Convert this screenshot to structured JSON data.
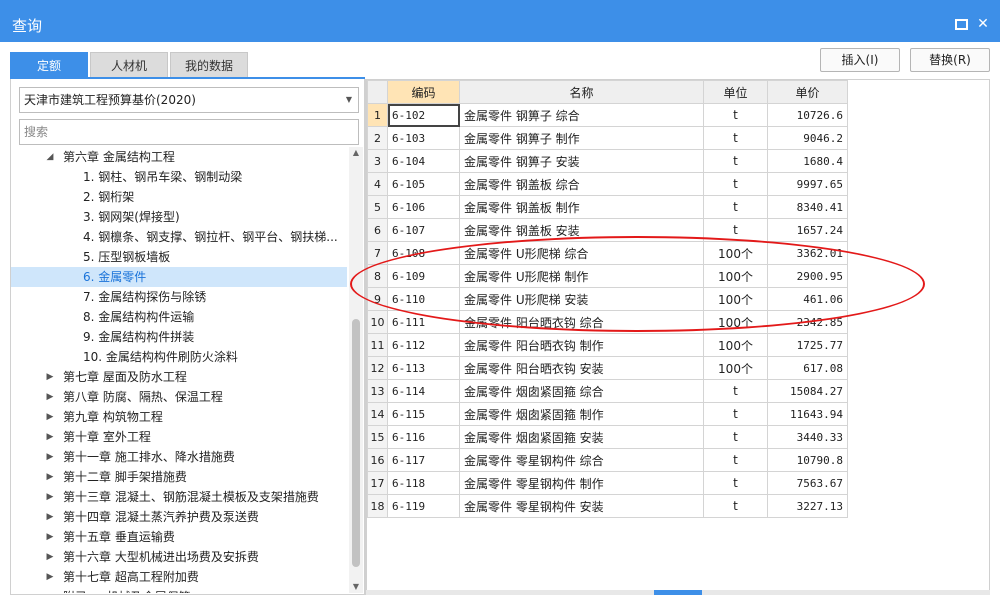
{
  "window": {
    "title": "查询"
  },
  "tabs": [
    "定额",
    "人材机",
    "我的数据"
  ],
  "actions": {
    "insert_label": "插入(I)",
    "replace_label": "替换(R)"
  },
  "left": {
    "selected_base": "天津市建筑工程预算基价(2020)",
    "search_placeholder": "搜索",
    "tree": [
      {
        "label": "第六章 金属结构工程",
        "level": 1,
        "expanded": true
      },
      {
        "label": "1. 钢柱、钢吊车梁、钢制动梁",
        "level": 2
      },
      {
        "label": "2. 钢桁架",
        "level": 2
      },
      {
        "label": "3. 钢网架(焊接型)",
        "level": 2
      },
      {
        "label": "4. 钢檩条、钢支撑、钢拉杆、钢平台、钢扶梯...",
        "level": 2
      },
      {
        "label": "5. 压型钢板墙板",
        "level": 2
      },
      {
        "label": "6. 金属零件",
        "level": 2,
        "selected": true
      },
      {
        "label": "7. 金属结构探伤与除锈",
        "level": 2
      },
      {
        "label": "8. 金属结构构件运输",
        "level": 2
      },
      {
        "label": "9. 金属结构构件拼装",
        "level": 2
      },
      {
        "label": "10. 金属结构构件刷防火涂料",
        "level": 2
      },
      {
        "label": "第七章 屋面及防水工程",
        "level": 1
      },
      {
        "label": "第八章 防腐、隔热、保温工程",
        "level": 1
      },
      {
        "label": "第九章 构筑物工程",
        "level": 1
      },
      {
        "label": "第十章 室外工程",
        "level": 1
      },
      {
        "label": "第十一章 施工排水、降水措施费",
        "level": 1
      },
      {
        "label": "第十二章 脚手架措施费",
        "level": 1
      },
      {
        "label": "第十三章 混凝土、钢筋混凝土模板及支架措施费",
        "level": 1
      },
      {
        "label": "第十四章 混凝土蒸汽养护费及泵送费",
        "level": 1
      },
      {
        "label": "第十五章 垂直运输费",
        "level": 1
      },
      {
        "label": "第十六章 大型机械进出场费及安拆费",
        "level": 1
      },
      {
        "label": "第十七章 超高工程附加费",
        "level": 1
      },
      {
        "label": "附录 一 机械及金属保管",
        "level": 1
      }
    ]
  },
  "grid": {
    "columns": [
      "编码",
      "名称",
      "单位",
      "单价"
    ],
    "rows": [
      {
        "idx": "1",
        "code": "6-102",
        "name": "金属零件 钢箅子 综合",
        "unit": "t",
        "price": "10726.6"
      },
      {
        "idx": "2",
        "code": "6-103",
        "name": "金属零件 钢箅子 制作",
        "unit": "t",
        "price": "9046.2"
      },
      {
        "idx": "3",
        "code": "6-104",
        "name": "金属零件 钢箅子 安装",
        "unit": "t",
        "price": "1680.4"
      },
      {
        "idx": "4",
        "code": "6-105",
        "name": "金属零件 钢盖板 综合",
        "unit": "t",
        "price": "9997.65"
      },
      {
        "idx": "5",
        "code": "6-106",
        "name": "金属零件 钢盖板 制作",
        "unit": "t",
        "price": "8340.41"
      },
      {
        "idx": "6",
        "code": "6-107",
        "name": "金属零件 钢盖板 安装",
        "unit": "t",
        "price": "1657.24"
      },
      {
        "idx": "7",
        "code": "6-108",
        "name": "金属零件 U形爬梯 综合",
        "unit": "100个",
        "price": "3362.01"
      },
      {
        "idx": "8",
        "code": "6-109",
        "name": "金属零件 U形爬梯 制作",
        "unit": "100个",
        "price": "2900.95"
      },
      {
        "idx": "9",
        "code": "6-110",
        "name": "金属零件 U形爬梯 安装",
        "unit": "100个",
        "price": "461.06"
      },
      {
        "idx": "10",
        "code": "6-111",
        "name": "金属零件 阳台晒衣钩 综合",
        "unit": "100个",
        "price": "2342.85"
      },
      {
        "idx": "11",
        "code": "6-112",
        "name": "金属零件 阳台晒衣钩 制作",
        "unit": "100个",
        "price": "1725.77"
      },
      {
        "idx": "12",
        "code": "6-113",
        "name": "金属零件 阳台晒衣钩 安装",
        "unit": "100个",
        "price": "617.08"
      },
      {
        "idx": "13",
        "code": "6-114",
        "name": "金属零件 烟囱紧固箍 综合",
        "unit": "t",
        "price": "15084.27"
      },
      {
        "idx": "14",
        "code": "6-115",
        "name": "金属零件 烟囱紧固箍 制作",
        "unit": "t",
        "price": "11643.94"
      },
      {
        "idx": "15",
        "code": "6-116",
        "name": "金属零件 烟囱紧固箍 安装",
        "unit": "t",
        "price": "3440.33"
      },
      {
        "idx": "16",
        "code": "6-117",
        "name": "金属零件 零星钢构件 综合",
        "unit": "t",
        "price": "10790.8"
      },
      {
        "idx": "17",
        "code": "6-118",
        "name": "金属零件 零星钢构件 制作",
        "unit": "t",
        "price": "7563.67"
      },
      {
        "idx": "18",
        "code": "6-119",
        "name": "金属零件 零星钢构件 安装",
        "unit": "t",
        "price": "3227.13"
      }
    ]
  },
  "annotation": {
    "color": "#e31919"
  },
  "icons": {
    "maximize": "maximize-icon",
    "close": "close-icon",
    "expand": "expand-arrow-icon",
    "collapse": "collapse-arrow-icon"
  }
}
